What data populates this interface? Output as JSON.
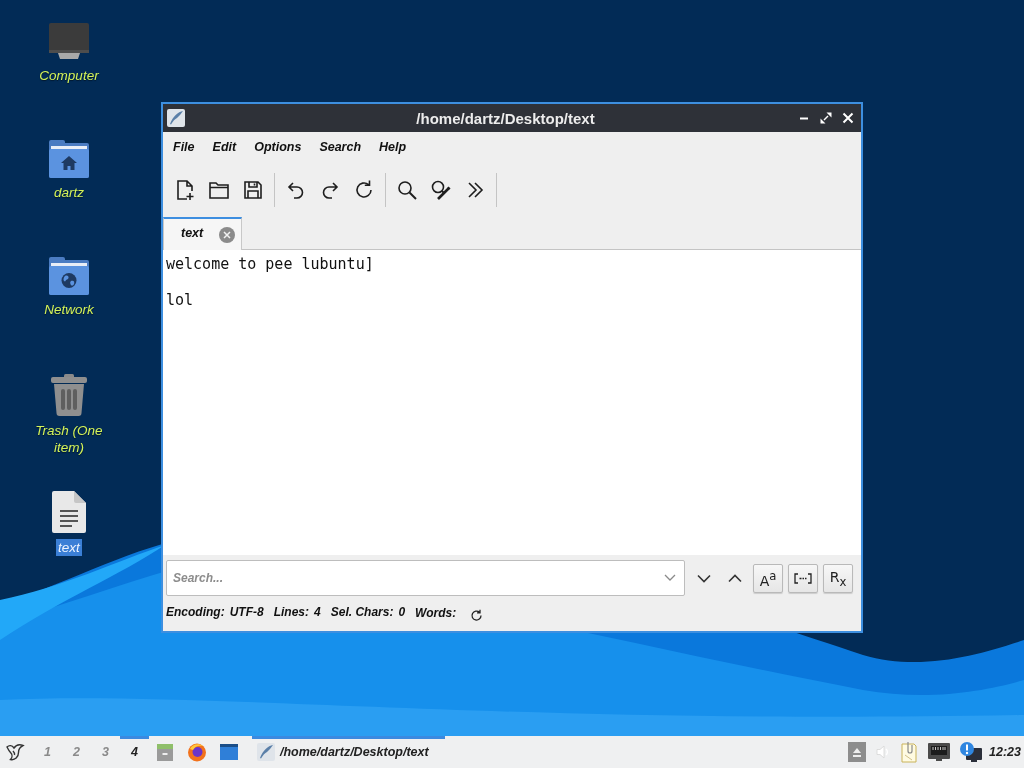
{
  "desktop_icons": [
    {
      "label": "Computer",
      "kind": "computer",
      "selected": false
    },
    {
      "label": "dartz",
      "kind": "home-folder",
      "selected": false
    },
    {
      "label": "Network",
      "kind": "network-folder",
      "selected": false
    },
    {
      "label": "Trash (One item)",
      "kind": "trash",
      "selected": false
    },
    {
      "label": "text",
      "kind": "document",
      "selected": true
    }
  ],
  "window": {
    "title": "/home/dartz/Desktop/text",
    "menu": [
      "File",
      "Edit",
      "Options",
      "Search",
      "Help"
    ],
    "tabs": [
      {
        "label": "text",
        "selected": true
      }
    ],
    "editor_text": "welcome to pee lubuntu]\n\nlol",
    "search": {
      "placeholder": "Search...",
      "options": [
        {
          "kind": "text",
          "label": "A$^{a}$"
        },
        {
          "kind": "whole-word"
        },
        {
          "kind": "text",
          "label": "R$_{x}$"
        }
      ]
    },
    "status": [
      {
        "kind": "value",
        "label": "Encoding:",
        "value": "UTF-8"
      },
      {
        "kind": "value",
        "label": "Lines:",
        "value": "4"
      },
      {
        "kind": "value",
        "label": "Sel. Chars:",
        "value": "0"
      },
      {
        "kind": "refresh",
        "label": "Words:"
      }
    ]
  },
  "taskbar": {
    "workspaces": [
      {
        "label": "1",
        "selected": false
      },
      {
        "label": "2",
        "selected": false
      },
      {
        "label": "3",
        "selected": false
      },
      {
        "label": "4",
        "selected": true
      }
    ],
    "tasks": [
      {
        "title": "/home/dartz/Desktop/text",
        "selected": true
      }
    ],
    "clock": "12:23"
  }
}
